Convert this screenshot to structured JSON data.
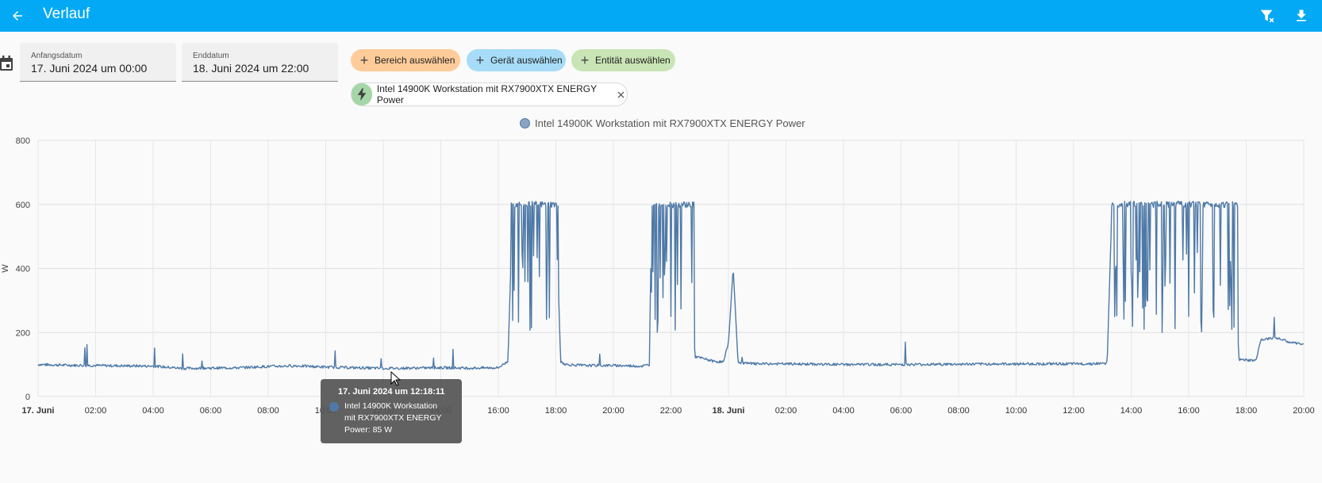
{
  "appbar": {
    "title": "Verlauf",
    "bg_color": "#03a9f4",
    "back_icon": "arrow-left-icon",
    "actions": [
      "filter-remove-icon",
      "download-icon"
    ]
  },
  "date_range": {
    "start": {
      "label": "Anfangsdatum",
      "value": "17. Juni 2024 um 00:00"
    },
    "end": {
      "label": "Enddatum",
      "value": "18. Juni 2024 um 22:00"
    }
  },
  "target_picker": {
    "area": {
      "label": "Bereich auswählen",
      "color": "#ffcc99"
    },
    "device": {
      "label": "Gerät auswählen",
      "color": "#a6dcf7"
    },
    "entity": {
      "label": "Entität auswählen",
      "color": "#c9e4b5"
    }
  },
  "selected_entity": {
    "name": "Intel 14900K Workstation mit RX7900XTX ENERGY Power",
    "icon": "lightning-bolt-icon"
  },
  "chart_data": {
    "type": "line",
    "title": "",
    "ylabel": "W",
    "xlabel": "",
    "ylim": [
      0,
      800
    ],
    "yticks": [
      0,
      200,
      400,
      600,
      800
    ],
    "legend_position": "top-center",
    "grid": true,
    "series_color": "#4e79a7",
    "x_ticks": [
      "17. Juni",
      "02:00",
      "04:00",
      "06:00",
      "08:00",
      "10:00",
      "12:00",
      "14:00",
      "16:00",
      "18:00",
      "20:00",
      "22:00",
      "18. Juni",
      "02:00",
      "04:00",
      "06:00",
      "08:00",
      "10:00",
      "12:00",
      "14:00",
      "16:00",
      "18:00",
      "20:00"
    ],
    "x_tick_bold": [
      true,
      false,
      false,
      false,
      false,
      false,
      false,
      false,
      false,
      false,
      false,
      false,
      true,
      false,
      false,
      false,
      false,
      false,
      false,
      false,
      false,
      false,
      false
    ],
    "series": [
      {
        "name": "Intel 14900K Workstation mit RX7900XTX ENERGY Power",
        "points": [
          [
            "17. Juni 00:00",
            100
          ],
          [
            "17. Juni 01:00",
            98
          ],
          [
            "17. Juni 02:00",
            97
          ],
          [
            "17. Juni 03:00",
            96
          ],
          [
            "17. Juni 04:00",
            95
          ],
          [
            "17. Juni 05:00",
            88
          ],
          [
            "17. Juni 06:00",
            89
          ],
          [
            "17. Juni 07:00",
            90
          ],
          [
            "17. Juni 08:00",
            94
          ],
          [
            "17. Juni 09:00",
            96
          ],
          [
            "17. Juni 10:00",
            92
          ],
          [
            "17. Juni 11:00",
            90
          ],
          [
            "17. Juni 12:00",
            88
          ],
          [
            "17. Juni 13:00",
            89
          ],
          [
            "17. Juni 14:00",
            90
          ],
          [
            "17. Juni 15:00",
            89
          ],
          [
            "17. Juni 16:00",
            90
          ],
          [
            "17. Juni 16:20",
            110
          ],
          [
            "17. Juni 16:30",
            600
          ],
          [
            "17. Juni 17:00",
            590
          ],
          [
            "17. Juni 17:30",
            480
          ],
          [
            "17. Juni 18:00",
            600
          ],
          [
            "17. Juni 18:10",
            110
          ],
          [
            "17. Juni 18:20",
            100
          ],
          [
            "17. Juni 19:00",
            97
          ],
          [
            "17. Juni 20:00",
            97
          ],
          [
            "17. Juni 21:00",
            95
          ],
          [
            "17. Juni 21:15",
            100
          ],
          [
            "17. Juni 21:20",
            600
          ],
          [
            "17. Juni 21:50",
            560
          ],
          [
            "17. Juni 22:20",
            580
          ],
          [
            "17. Juni 22:40",
            600
          ],
          [
            "17. Juni 22:50",
            125
          ],
          [
            "17. Juni 23:30",
            110
          ],
          [
            "17. Juni 23:50",
            108
          ],
          [
            "18. Juni 00:00",
            170
          ],
          [
            "18. Juni 00:10",
            400
          ],
          [
            "18. Juni 00:20",
            105
          ],
          [
            "18. Juni 01:00",
            102
          ],
          [
            "18. Juni 02:00",
            102
          ],
          [
            "18. Juni 04:00",
            100
          ],
          [
            "18. Juni 06:00",
            100
          ],
          [
            "18. Juni 08:00",
            101
          ],
          [
            "18. Juni 10:00",
            102
          ],
          [
            "18. Juni 12:00",
            102
          ],
          [
            "18. Juni 13:00",
            103
          ],
          [
            "18. Juni 13:10",
            105
          ],
          [
            "18. Juni 13:20",
            600
          ],
          [
            "18. Juni 14:00",
            590
          ],
          [
            "18. Juni 14:50",
            570
          ],
          [
            "18. Juni 15:30",
            580
          ],
          [
            "18. Juni 16:30",
            600
          ],
          [
            "18. Juni 17:30",
            590
          ],
          [
            "18. Juni 17:45",
            115
          ],
          [
            "18. Juni 18:20",
            112
          ],
          [
            "18. Juni 18:30",
            175
          ],
          [
            "18. Juni 19:00",
            185
          ],
          [
            "18. Juni 19:30",
            170
          ],
          [
            "18. Juni 20:00",
            162
          ],
          [
            "18. Juni 20:30",
            160
          ]
        ]
      }
    ]
  },
  "tooltip": {
    "title": "17. Juni 2024 um 12:18:11",
    "line1": "Intel 14900K Workstation",
    "line2": "mit RX7900XTX ENERGY",
    "line3": "Power: 85 W"
  }
}
